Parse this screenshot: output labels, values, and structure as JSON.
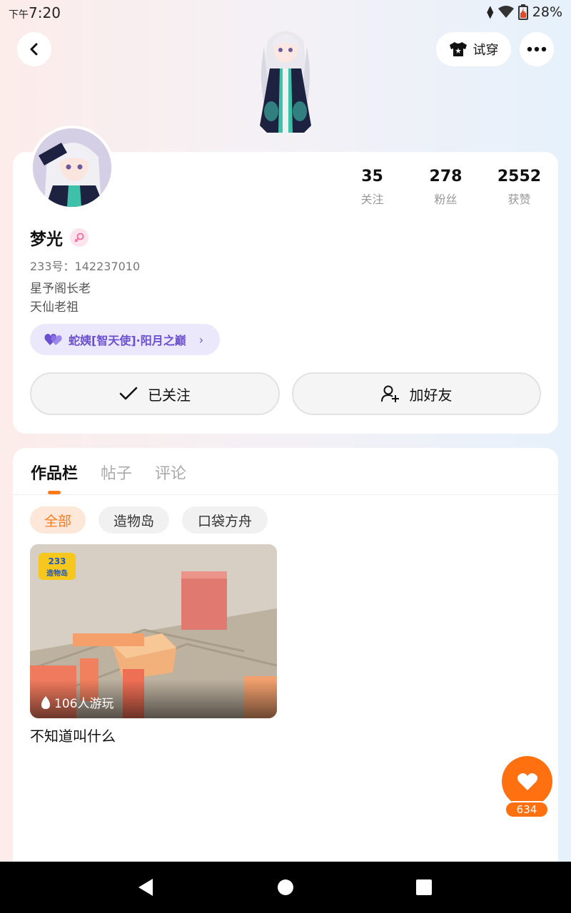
{
  "status": {
    "time_prefix": "下午",
    "time": "7:20",
    "battery": "28%"
  },
  "header": {
    "tryon_label": "试穿"
  },
  "profile": {
    "stats": [
      {
        "num": "35",
        "label": "关注"
      },
      {
        "num": "278",
        "label": "粉丝"
      },
      {
        "num": "2552",
        "label": "获赞"
      }
    ],
    "username": "梦光",
    "user_id": "233号：142237010",
    "bio_lines": [
      "星予阁长老",
      "天仙老祖"
    ],
    "title_badge": "蛇姨[智天使]·阳月之巅",
    "follow_label": "已关注",
    "add_friend_label": "加好友"
  },
  "tabs": [
    {
      "label": "作品栏",
      "active": true
    },
    {
      "label": "帖子",
      "active": false
    },
    {
      "label": "评论",
      "active": false
    }
  ],
  "filters": [
    {
      "label": "全部",
      "active": true
    },
    {
      "label": "造物岛",
      "active": false
    },
    {
      "label": "口袋方舟",
      "active": false
    }
  ],
  "games": [
    {
      "title": "不知道叫什么",
      "play_count": "106人游玩",
      "logo_text": "233 造物岛"
    }
  ],
  "like": {
    "count": "634"
  },
  "colors": {
    "accent": "#ff7a1a",
    "badge_purple": "#6b4fcf"
  }
}
